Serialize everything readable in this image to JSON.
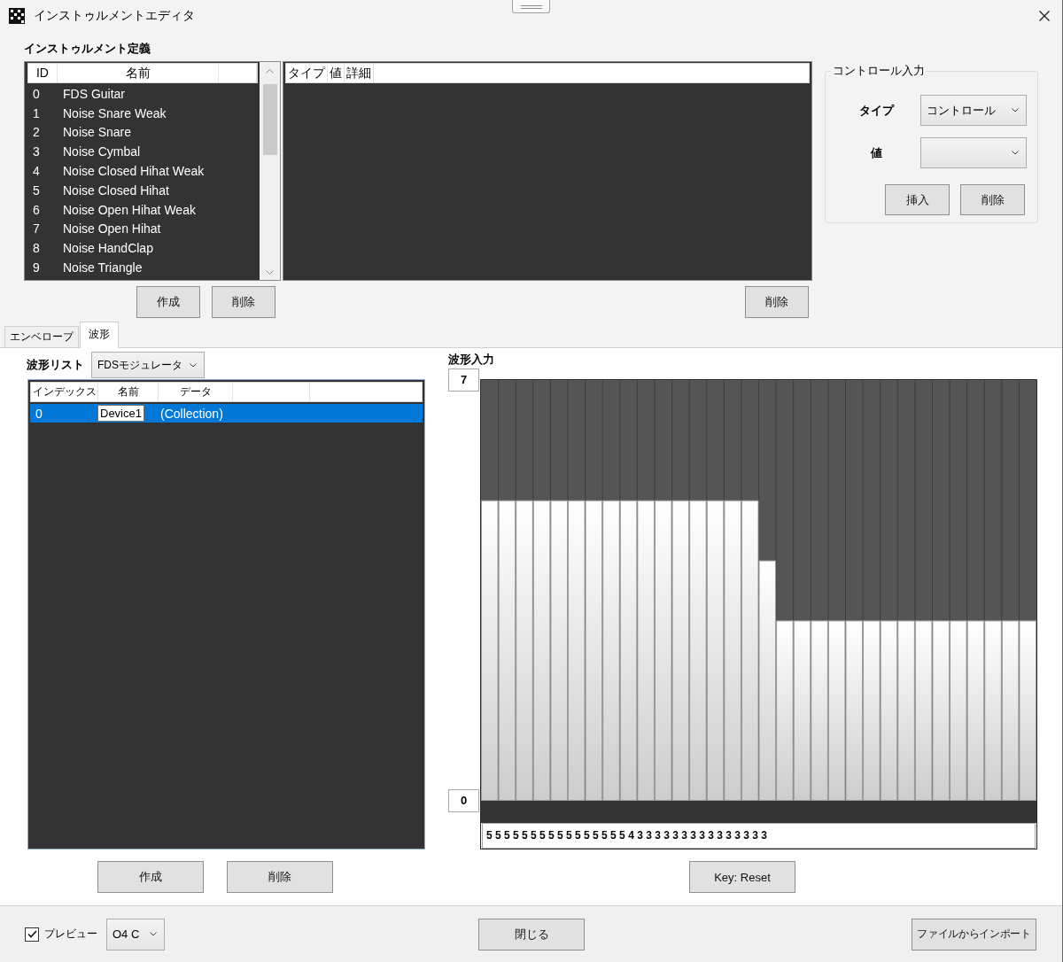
{
  "window": {
    "title": "インストゥルメントエディタ"
  },
  "instrument_definition": {
    "title": "インストゥルメント定義",
    "instrument_list": {
      "columns": [
        "ID",
        "名前"
      ],
      "rows": [
        {
          "id": "0",
          "name": "FDS Guitar"
        },
        {
          "id": "1",
          "name": "Noise Snare Weak"
        },
        {
          "id": "2",
          "name": "Noise Snare"
        },
        {
          "id": "3",
          "name": "Noise Cymbal"
        },
        {
          "id": "4",
          "name": "Noise Closed Hihat Weak"
        },
        {
          "id": "5",
          "name": "Noise Closed Hihat"
        },
        {
          "id": "6",
          "name": "Noise Open Hihat Weak"
        },
        {
          "id": "7",
          "name": "Noise Open Hihat"
        },
        {
          "id": "8",
          "name": "Noise HandClap"
        },
        {
          "id": "9",
          "name": "Noise Triangle"
        }
      ]
    },
    "instrument_buttons": [
      "作成",
      "削除"
    ],
    "control_list": {
      "columns": [
        "タイプ",
        "値",
        "詳細"
      ]
    },
    "control_list_buttons": [
      "削除"
    ]
  },
  "control_input": {
    "title": "コントロール入力",
    "type_label": "タイプ",
    "type_value": "コントロール",
    "value_label": "値",
    "buttons": [
      "挿入",
      "削除"
    ]
  },
  "tabs": [
    {
      "label": "エンベロープ",
      "selected": false
    },
    {
      "label": "波形",
      "selected": true
    }
  ],
  "waveform_list": {
    "label": "波形リスト",
    "source": "FDSモジュレータ",
    "columns": [
      "インデックス",
      "名前",
      "データ"
    ],
    "rows": [
      {
        "index": "0",
        "name": "Device1",
        "data": "(Collection)",
        "selected": true,
        "editing": true
      }
    ],
    "buttons": [
      "作成",
      "削除"
    ]
  },
  "waveform_input": {
    "label": "波形入力",
    "chart_data": {
      "type": "bar",
      "categories": [
        null,
        null,
        null,
        null,
        null,
        null,
        null,
        null,
        null,
        null,
        null,
        null,
        null,
        null,
        null,
        null,
        null,
        null,
        null,
        null,
        null,
        null,
        null,
        null,
        null,
        null,
        null,
        null,
        null,
        null,
        null,
        null
      ],
      "values": [
        5,
        5,
        5,
        5,
        5,
        5,
        5,
        5,
        5,
        5,
        5,
        5,
        5,
        5,
        5,
        5,
        4,
        3,
        3,
        3,
        3,
        3,
        3,
        3,
        3,
        3,
        3,
        3,
        3,
        3,
        3,
        3
      ],
      "ylim": [
        0,
        7
      ],
      "yticks": [
        {
          "value": 0,
          "label": "0"
        },
        {
          "value": 7,
          "label": "7"
        }
      ]
    },
    "values_text": "5 5 5 5 5 5 5 5 5 5 5 5 5 5 5 5 4 3 3 3 3 3 3 3 3 3 3 3 3 3 3 3",
    "buttons": [
      "Key: Reset"
    ]
  },
  "footer": {
    "preview": {
      "label": "プレビュー",
      "checked": true
    },
    "note": "O4 C",
    "buttons": [
      "閉じる",
      "ファイルからインポート"
    ]
  }
}
